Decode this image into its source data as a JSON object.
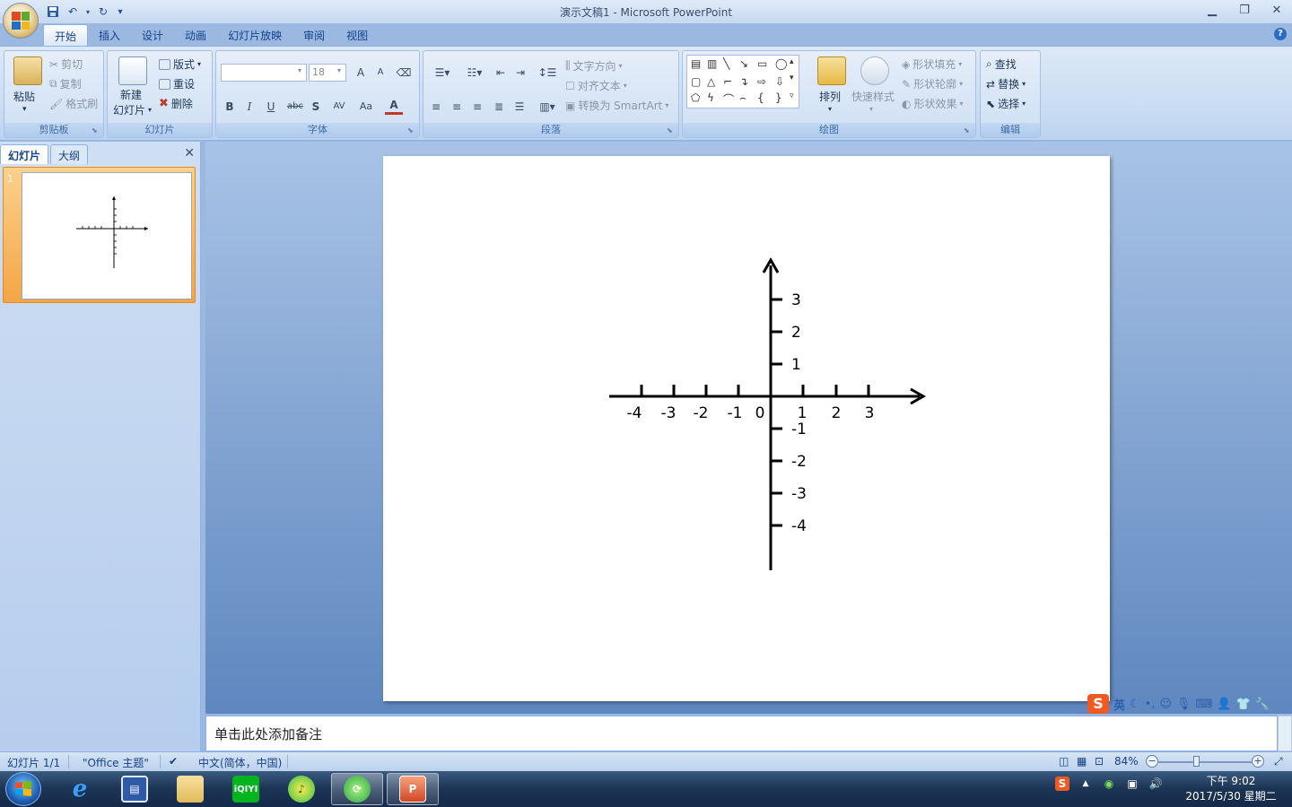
{
  "window": {
    "title": "演示文稿1 - Microsoft PowerPoint",
    "minimize": "▁",
    "restore": "❐",
    "close": "✕"
  },
  "quick_access": {
    "save_icon": "save-icon",
    "undo_icon": "undo-icon",
    "redo_icon": "redo-icon",
    "customize": "▾"
  },
  "tabs": [
    "开始",
    "插入",
    "设计",
    "动画",
    "幻灯片放映",
    "审阅",
    "视图"
  ],
  "active_tab": "开始",
  "ribbon": {
    "clipboard": {
      "label": "剪贴板",
      "paste": "粘贴",
      "cut": "剪切",
      "copy": "复制",
      "format_painter": "格式刷"
    },
    "slides": {
      "label": "幻灯片",
      "new_slide": "新建",
      "new_slide_2": "幻灯片",
      "layout": "版式",
      "reset": "重设",
      "delete": "删除"
    },
    "font": {
      "label": "字体",
      "font_name": "",
      "font_size": "18",
      "bold": "B",
      "italic": "I",
      "underline": "U",
      "strike": "abc",
      "shadow": "S",
      "spacing": "AV",
      "change_case": "Aa",
      "font_color": "A",
      "grow": "A",
      "shrink": "A"
    },
    "paragraph": {
      "label": "段落",
      "text_direction": "文字方向",
      "align_text": "对齐文本",
      "convert_smartart": "转换为 SmartArt"
    },
    "drawing": {
      "label": "绘图",
      "arrange": "排列",
      "quick_styles": "快速样式",
      "shape_fill": "形状填充",
      "shape_outline": "形状轮廓",
      "shape_effects": "形状效果"
    },
    "editing": {
      "label": "编辑",
      "find": "查找",
      "replace": "替换",
      "select": "选择"
    }
  },
  "left_panel": {
    "tab_slides": "幻灯片",
    "tab_outline": "大纲",
    "close": "✕",
    "slide_number": "1"
  },
  "slide": {
    "axis_x_labels": [
      "-4",
      "-3",
      "-2",
      "-1",
      "0",
      "1",
      "2",
      "3"
    ],
    "axis_y_labels_pos": [
      "3",
      "2",
      "1"
    ],
    "axis_y_labels_neg": [
      "-1",
      "-2",
      "-3",
      "-4"
    ]
  },
  "notes": {
    "placeholder": "单击此处添加备注"
  },
  "ime": {
    "logo": "S",
    "mode": "英"
  },
  "status": {
    "slide_pos": "幻灯片 1/1",
    "theme": "\"Office 主题\"",
    "language": "中文(简体，中国)",
    "zoom": "84%",
    "zoom_value_percent": 84,
    "zoom_minus": "−",
    "zoom_plus": "+"
  },
  "taskbar": {
    "apps": [
      "internet-explorer",
      "media-center",
      "file-explorer",
      "iqiyi",
      "qq-music",
      "360-browser",
      "powerpoint"
    ],
    "active_app": "powerpoint",
    "iqiyi_label": "iQIYI",
    "clock_time": "下午 9:02",
    "clock_date": "2017/5/30 星期二"
  },
  "colors": {
    "accent": "#15428b",
    "ribbon_bg": "#dbe8f7",
    "slide_pane_selected": "#f4a546",
    "ime_orange": "#ef5a24"
  }
}
